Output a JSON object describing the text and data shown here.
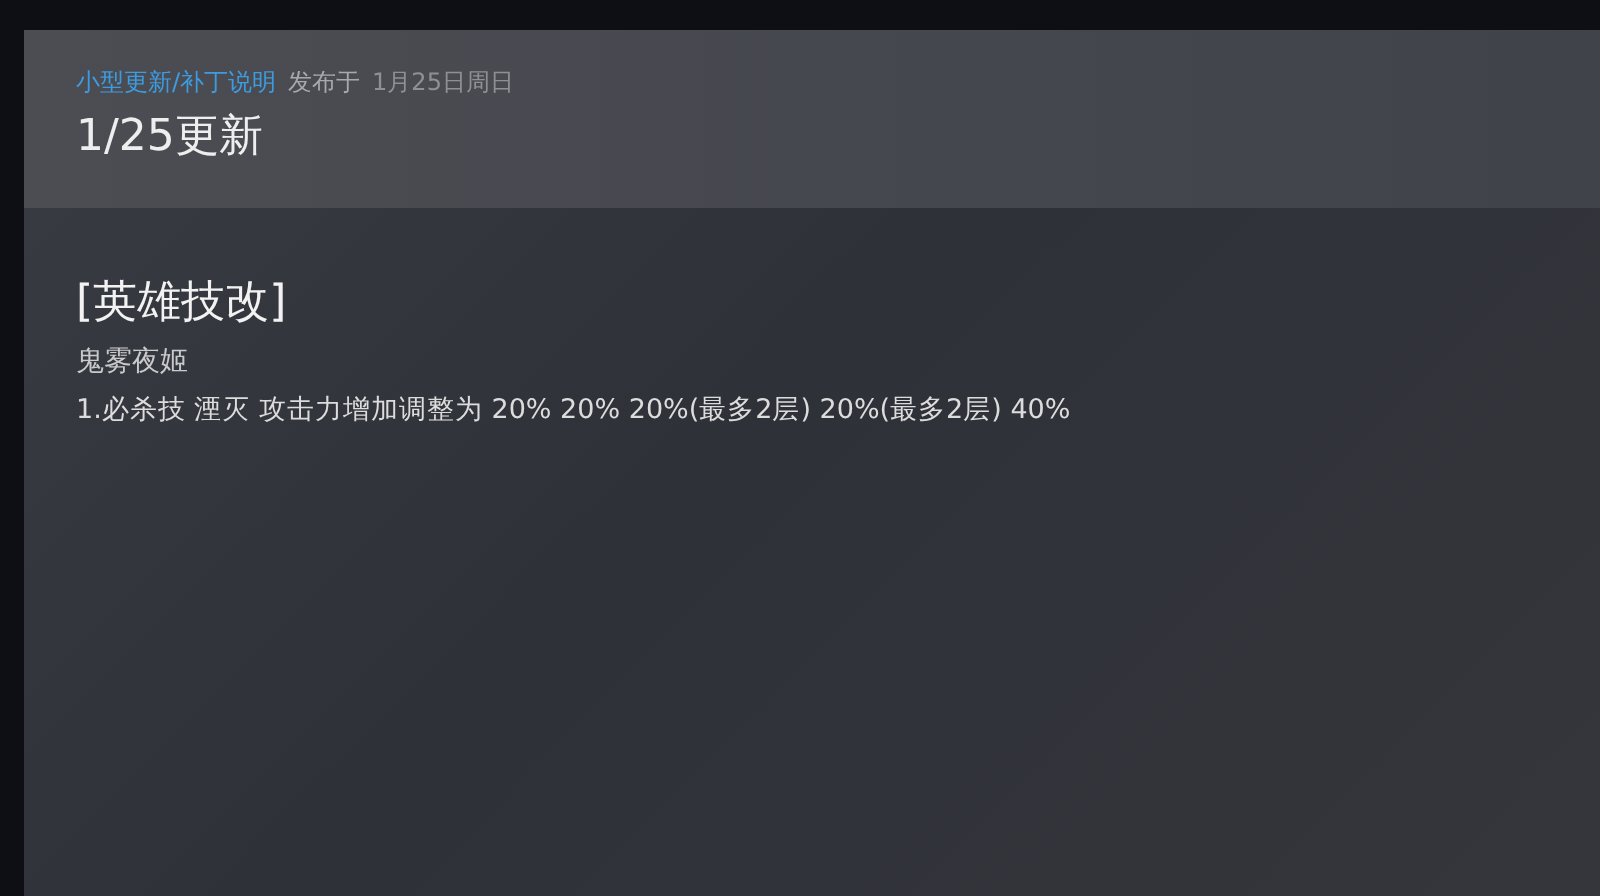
{
  "header": {
    "category": "小型更新/补丁说明",
    "posted_label": "发布于",
    "date": "1月25日周日",
    "title": "1/25更新"
  },
  "body": {
    "section_title": "[英雄技改]",
    "hero": "鬼雾夜姬",
    "lines": [
      "1.必杀技 湮灭 攻击力增加调整为 20% 20% 20%(最多2层) 20%(最多2层) 40%"
    ]
  }
}
